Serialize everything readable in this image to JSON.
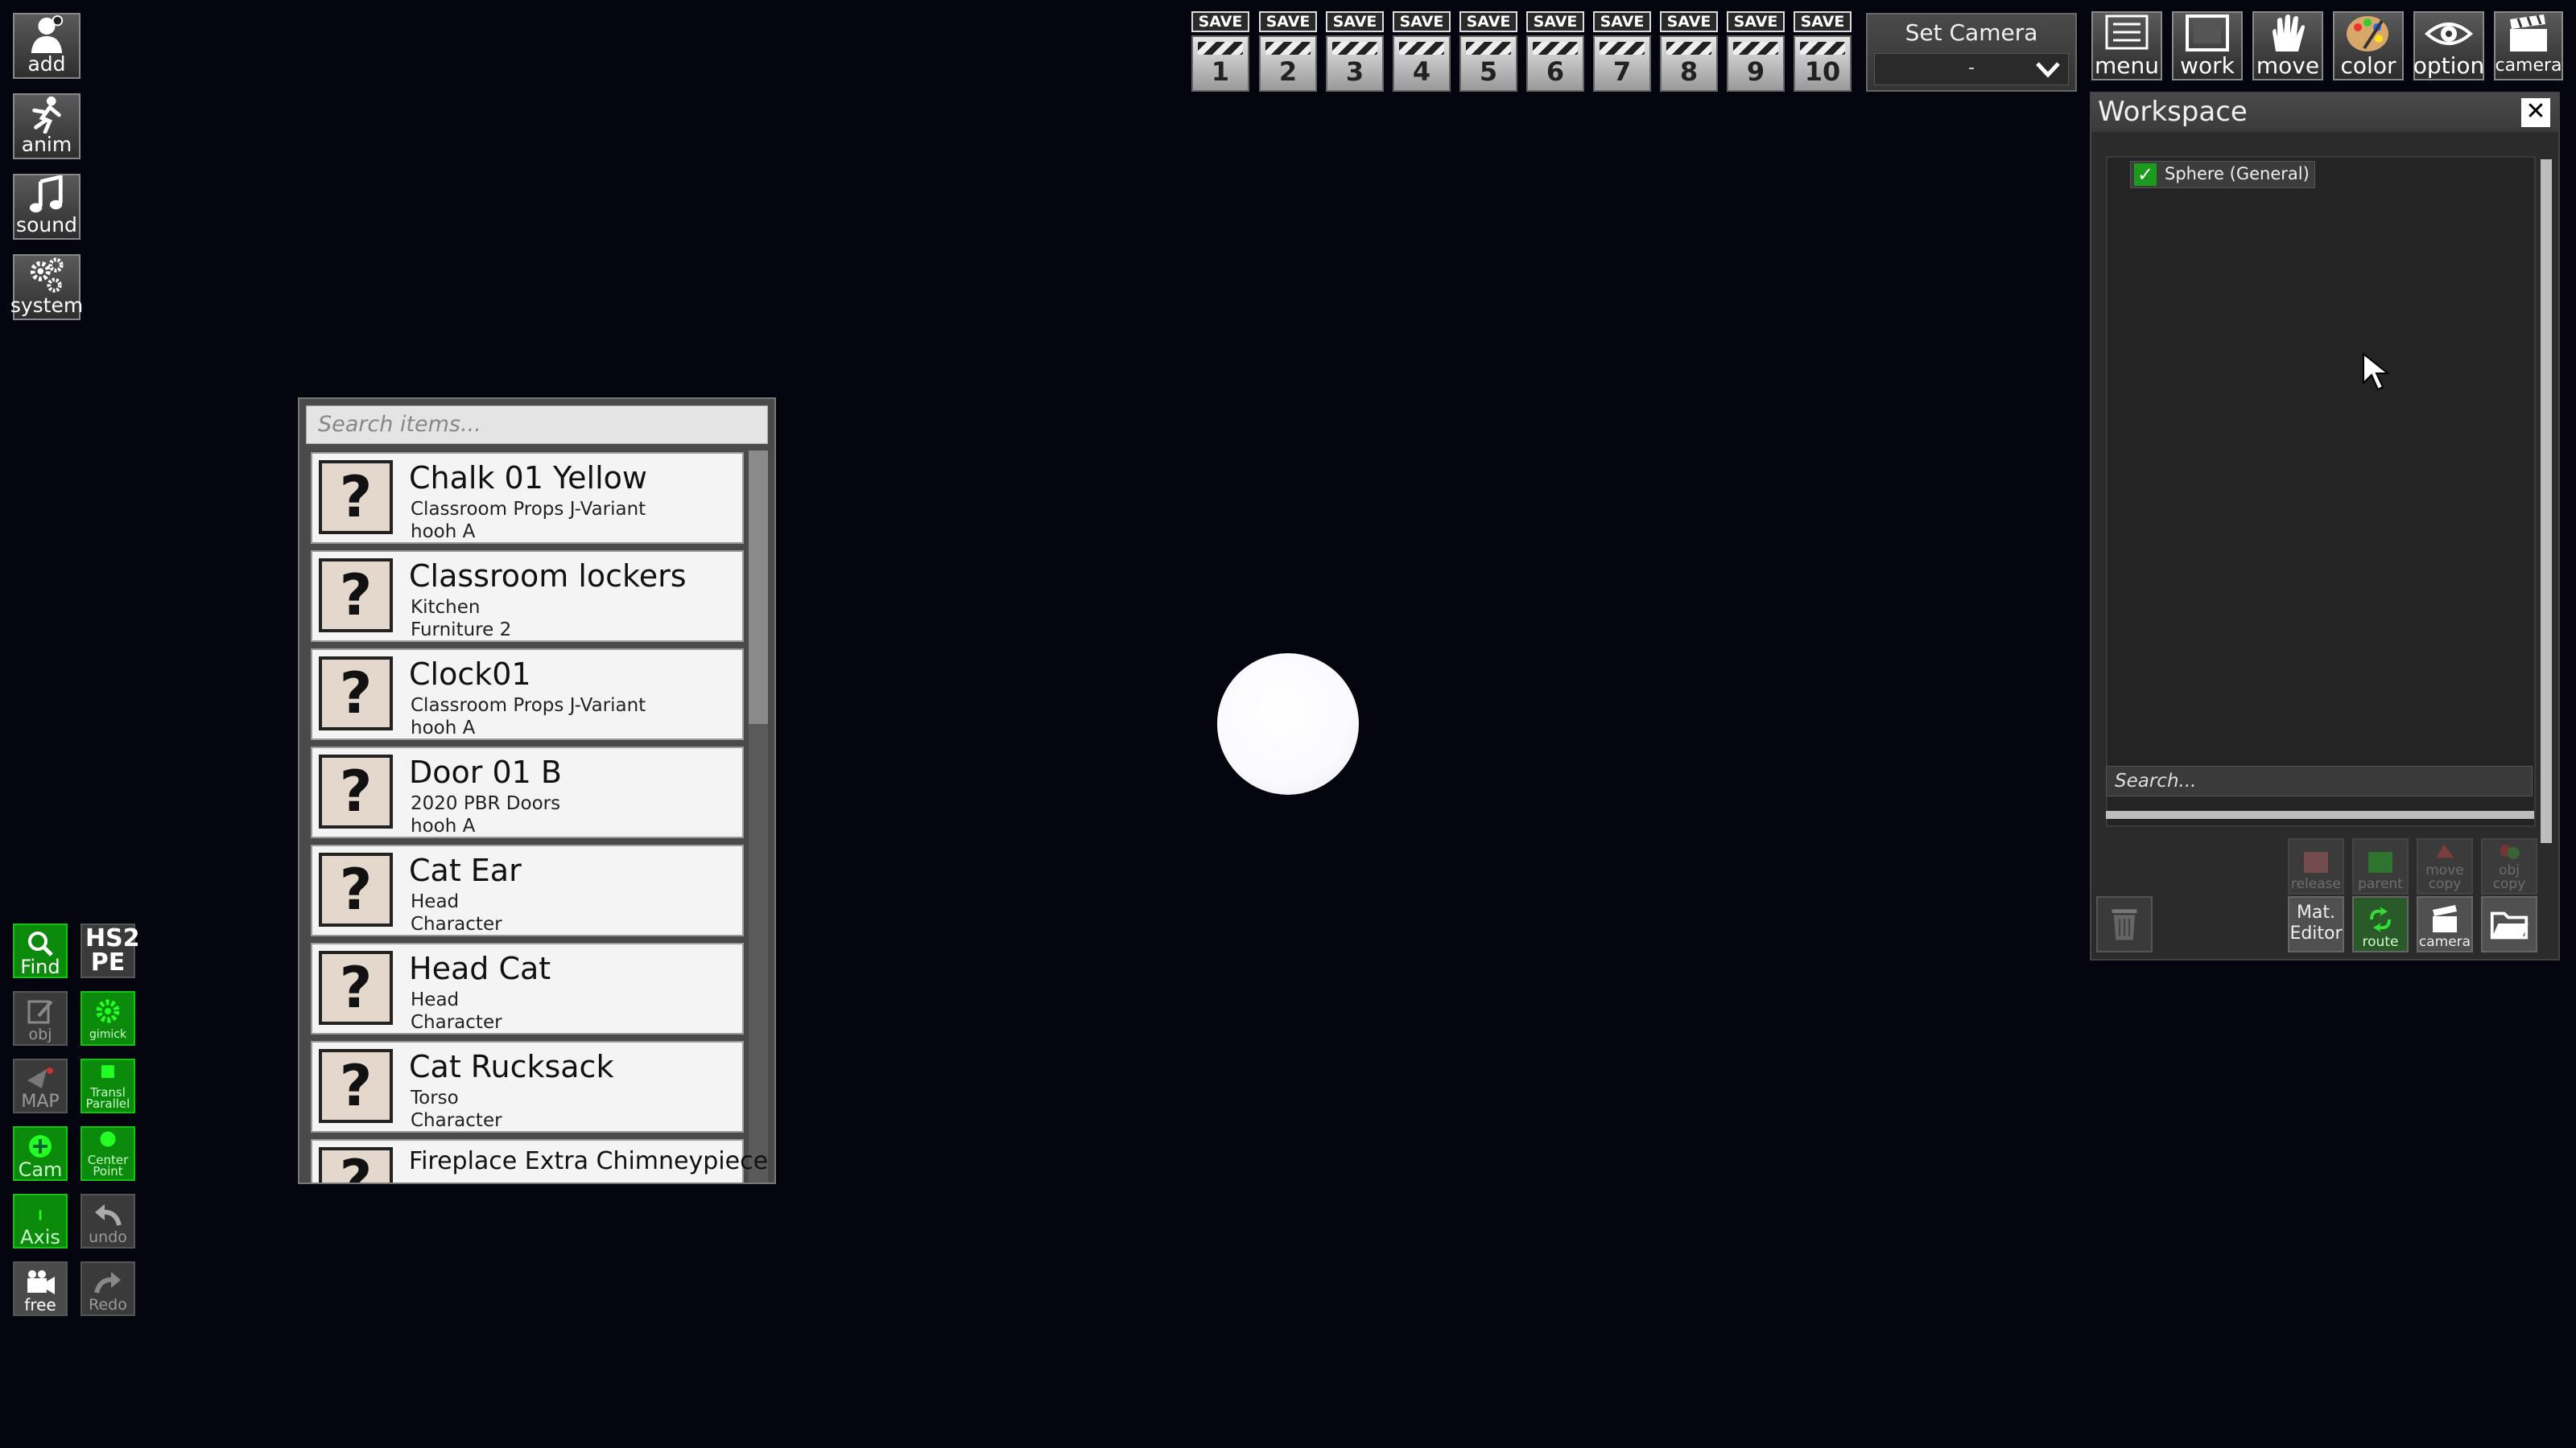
{
  "left_menu": [
    {
      "label": "add",
      "icon": "add-character-icon"
    },
    {
      "label": "anim",
      "icon": "running-figure-icon"
    },
    {
      "label": "sound",
      "icon": "music-note-icon"
    },
    {
      "label": "system",
      "icon": "gears-icon"
    }
  ],
  "tools": {
    "find": "Find",
    "hs2pe": "HS2 PE",
    "obj": "obj",
    "gimmick": "gimick",
    "map": "MAP",
    "transl_parallel": "Transl Parallel",
    "cam": "Cam",
    "center_point": "Center Point",
    "axis": "Axis",
    "undo": "undo",
    "free": "free",
    "redo": "Redo"
  },
  "save_slots": {
    "save_label": "SAVE",
    "numbers": [
      "1",
      "2",
      "3",
      "4",
      "5",
      "6",
      "7",
      "8",
      "9",
      "10"
    ]
  },
  "set_camera": {
    "title": "Set Camera",
    "value": "-"
  },
  "top_menu": [
    {
      "label": "menu",
      "icon": "list-icon"
    },
    {
      "label": "work",
      "icon": "frame-icon"
    },
    {
      "label": "move",
      "icon": "hand-icon"
    },
    {
      "label": "color",
      "icon": "palette-icon"
    },
    {
      "label": "option",
      "icon": "eye-icon"
    },
    {
      "label": "camera",
      "icon": "clapper-icon"
    }
  ],
  "workspace": {
    "title": "Workspace",
    "close": "✕",
    "tree_item": "Sphere (General)",
    "search_placeholder": "Search...",
    "buttons": {
      "release": "release",
      "parent": "parent",
      "move_copy": "move copy",
      "obj_copy": "obj copy",
      "mat_editor": "Mat. Editor",
      "route": "route",
      "camera": "camera"
    }
  },
  "item_list": {
    "search_placeholder": "Search items...",
    "items": [
      {
        "name": "Chalk 01 Yellow",
        "cat1": "Classroom Props J-Variant",
        "cat2": "hooh A"
      },
      {
        "name": "Classroom lockers",
        "cat1": "Kitchen",
        "cat2": "Furniture 2"
      },
      {
        "name": "Clock01",
        "cat1": "Classroom Props J-Variant",
        "cat2": "hooh A"
      },
      {
        "name": "Door 01 B",
        "cat1": "2020 PBR Doors",
        "cat2": "hooh A"
      },
      {
        "name": "Cat Ear",
        "cat1": "Head",
        "cat2": "Character"
      },
      {
        "name": "Head Cat",
        "cat1": "Head",
        "cat2": "Character"
      },
      {
        "name": "Cat Rucksack",
        "cat1": "Torso",
        "cat2": "Character"
      },
      {
        "name": "Fireplace Extra Chimneypiece",
        "cat1": "",
        "cat2": ""
      }
    ]
  }
}
